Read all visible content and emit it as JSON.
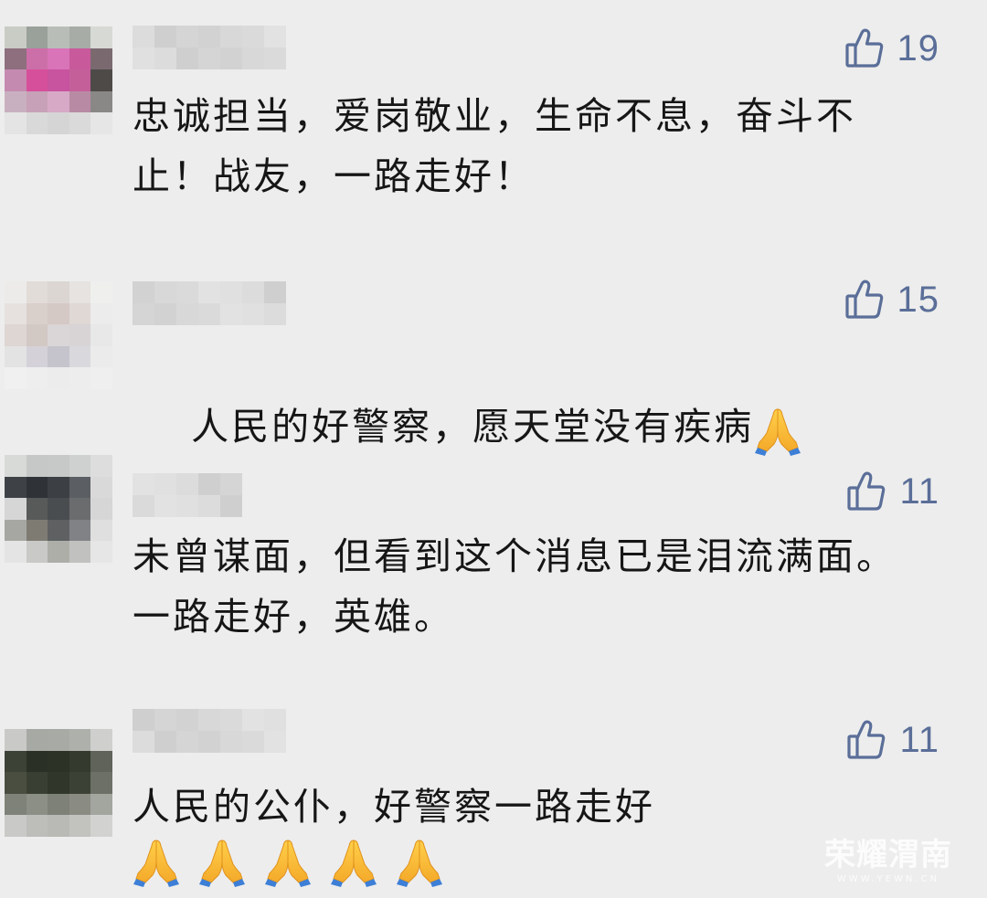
{
  "comments": [
    {
      "likes": "19",
      "text": "忠诚担当，爱岗敬业，生命不息，奋斗不止！战友，一路走好！",
      "avatar_colors": [
        "#c8ccc4",
        "#9aa09a",
        "#b9bdb8",
        "#a8aca6",
        "#d7d9d5",
        "#8d6f7d",
        "#cc6fa8",
        "#d974b8",
        "#c85a9c",
        "#7a6a70",
        "#c58ab0",
        "#d64f9a",
        "#c8539f",
        "#c45f9a",
        "#4e4a48",
        "#c9b0c0",
        "#c7a1b8",
        "#d7a9c6",
        "#b88aa4",
        "#8a8886",
        "#e4e4e4",
        "#d9d9d9",
        "#d5d5d5",
        "#dadada",
        "#e6e6e6"
      ]
    },
    {
      "likes": "15",
      "text": "人民的好警察，愿天堂没有疾病",
      "emoji_name": "folded-hands",
      "avatar_colors": [
        "#ecebe9",
        "#e1dcd8",
        "#dcd6d2",
        "#e6e3e1",
        "#efefee",
        "#e6e1df",
        "#d9cfcb",
        "#d5c9c5",
        "#dfd8d5",
        "#ececec",
        "#ddd6d3",
        "#d2c8c4",
        "#dad5d6",
        "#d8d3d4",
        "#e9e8e8",
        "#e4e3e4",
        "#d4d2d8",
        "#c5c3cc",
        "#d9d8dc",
        "#ebebeb",
        "#f0f0f0",
        "#eeeeee",
        "#ececec",
        "#ededed",
        "#efefef"
      ]
    },
    {
      "likes": "11",
      "text": "未曾谋面，但看到这个消息已是泪流满面。一路走好，英雄。",
      "avatar_colors": [
        "#d8dad8",
        "#c5c8c6",
        "#c7c9c8",
        "#cfd1d1",
        "#dcdddc",
        "#3e4246",
        "#2f3338",
        "#3c4044",
        "#5b5f63",
        "#d9d9d9",
        "#d6d6d6",
        "#575a59",
        "#4a4d50",
        "#6a6c6e",
        "#d6d6d6",
        "#a6a7a3",
        "#7e7b73",
        "#5e6062",
        "#808285",
        "#dfdfdf",
        "#e4e4e4",
        "#c9c9c7",
        "#aeaea9",
        "#c1c1bf",
        "#e6e6e6"
      ]
    },
    {
      "likes": "11",
      "text": "人民的公仆，好警察一路走好",
      "emoji_name": "folded-hands",
      "emoji_count": 5,
      "avatar_colors": [
        "#c9cac7",
        "#a7aaa4",
        "#a8aba5",
        "#aeb0ac",
        "#cfd0ce",
        "#3d4236",
        "#2a3025",
        "#2d3226",
        "#343a2e",
        "#5f635a",
        "#4a4e41",
        "#3a3f33",
        "#30362a",
        "#3c4135",
        "#6d7067",
        "#7f8278",
        "#8c8f86",
        "#7e8177",
        "#8a8c84",
        "#a3a59f",
        "#c9c9c7",
        "#bdbdba",
        "#b9b9b6",
        "#c2c2bf",
        "#d2d2d0"
      ]
    }
  ],
  "watermark": {
    "title": "荣耀渭南",
    "subtitle": "WWW.YEWN.CN"
  }
}
